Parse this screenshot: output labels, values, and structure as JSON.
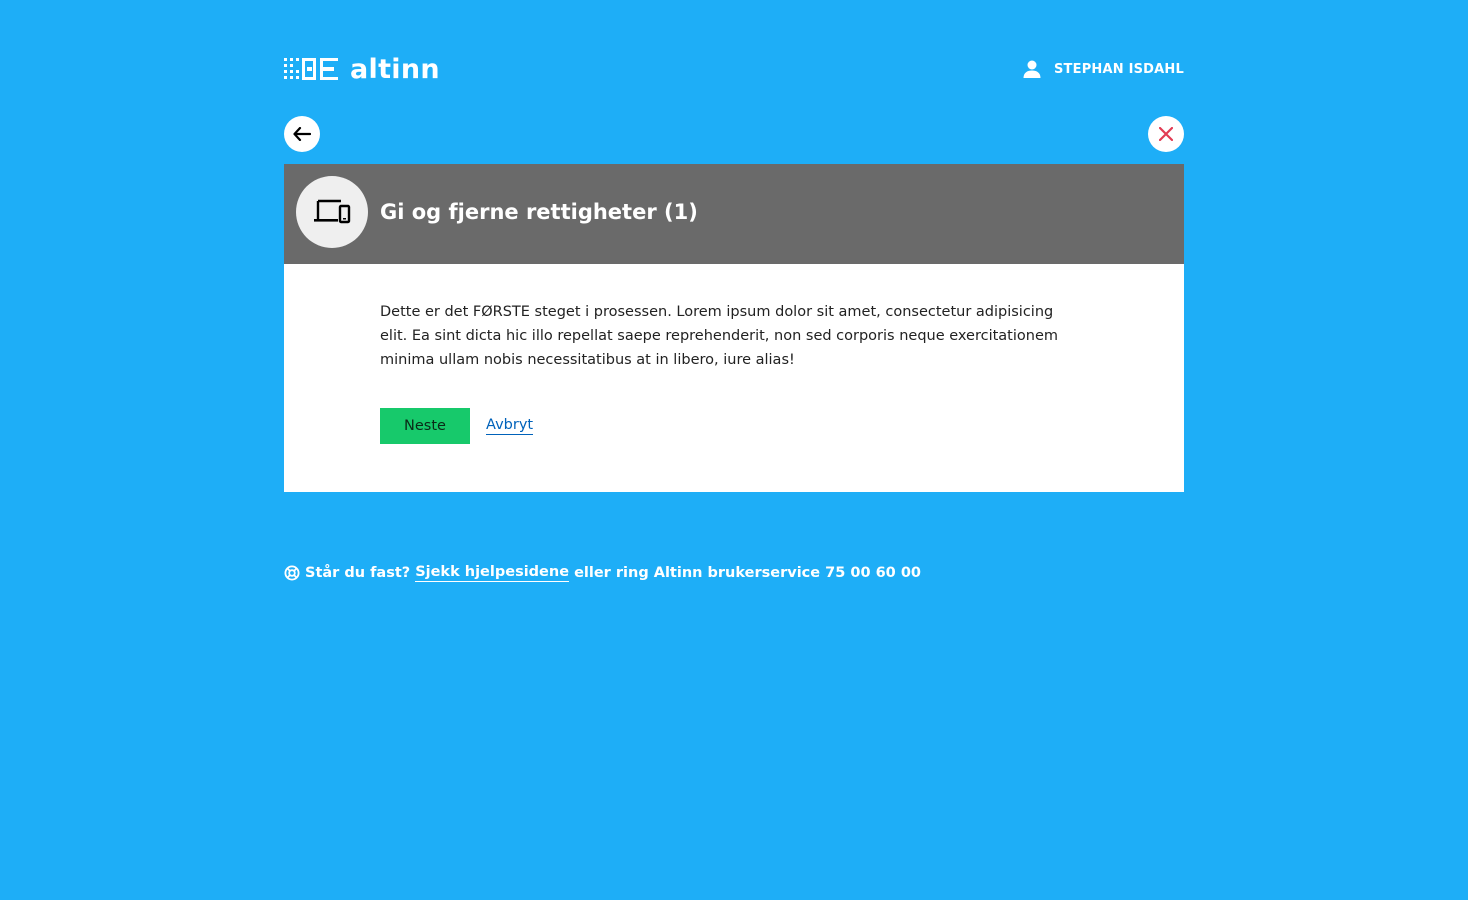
{
  "colors": {
    "page_background": "#1eaef7",
    "modal_header": "#6a6a6a",
    "primary_button": "#17c96b",
    "link": "#0062ba",
    "close_icon": "#e23b53"
  },
  "header": {
    "logo_text": "altinn",
    "logo_icon": "altinn-logo-mark",
    "user_icon": "person-icon",
    "user_name": "STEPHAN ISDAHL"
  },
  "nav": {
    "back_icon": "arrow-left-icon",
    "close_icon": "close-icon"
  },
  "modal": {
    "icon": "devices-icon",
    "title": "Gi og fjerne rettigheter (1)",
    "body_text": "Dette er det FØRSTE steget i prosessen. Lorem ipsum dolor sit amet, consectetur adipisicing elit. Ea sint dicta hic illo repellat saepe reprehenderit, non sed corporis neque exercitationem minima ullam nobis necessitatibus at in libero, iure alias!",
    "next_label": "Neste",
    "cancel_label": "Avbryt"
  },
  "help": {
    "icon": "lifebuoy-icon",
    "prefix": "Står du fast?",
    "link_text": "Sjekk hjelpesidene",
    "suffix": "eller ring Altinn brukerservice 75 00 60 00"
  }
}
